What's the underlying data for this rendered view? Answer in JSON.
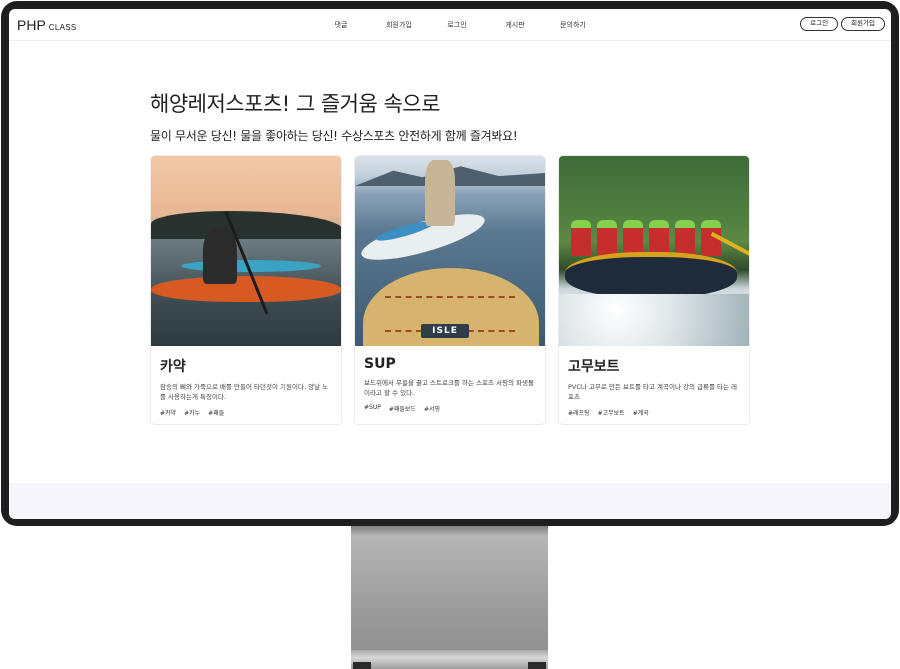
{
  "header": {
    "logo": "PHP",
    "logo_small": "CLASS",
    "nav": [
      "댓글",
      "회원가입",
      "로그인",
      "게시판",
      "문의하기"
    ],
    "auth": [
      "로그인",
      "회원가입"
    ]
  },
  "hero": {
    "title": "해양레저스포츠! 그 즐거움 속으로",
    "subtitle": "물이 무서운 당신! 물을 좋아하는 당신! 수상스포츠 안전하게 함께 즐겨봐요!"
  },
  "cards": [
    {
      "title": "카약",
      "desc": "잠승의 뼈와 가죽으로 배를 만들어 타던것이 기원이다. 양날 노를 사용하는게 특징이다.",
      "tags": [
        "#카약",
        "#카누",
        "#패들"
      ]
    },
    {
      "title": "SUP",
      "desc": "보드위에서 무릎을 꿇고 스트로크를 하는 스포츠 서핑의 파생돌이라고 할 수 있다.",
      "tags": [
        "#SUP",
        "#패들보드",
        "#서핑"
      ],
      "board_logo": "ISLE"
    },
    {
      "title": "고무보트",
      "desc": "PVC나 고무로 만든 보트를 타고 계곡이나 강의 급류를 타는 레포츠",
      "tags": [
        "#래프팅",
        "#고무보트",
        "#계곡"
      ]
    }
  ]
}
